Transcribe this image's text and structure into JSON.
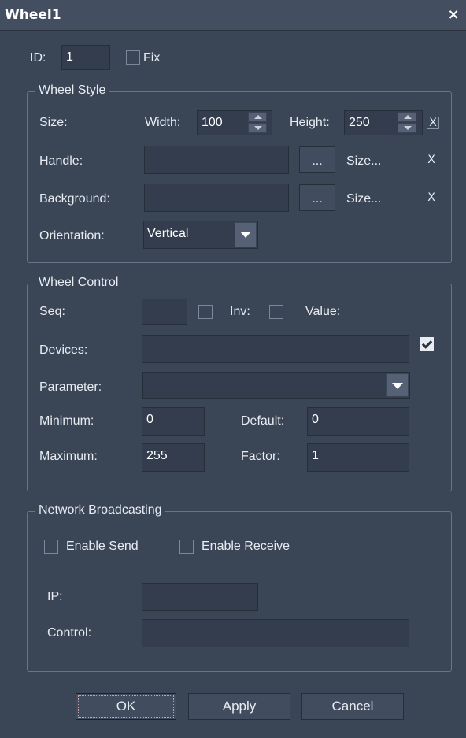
{
  "window": {
    "title": "Wheel1",
    "close_label": "×"
  },
  "id": {
    "label": "ID:",
    "value": "1",
    "fix_label": "Fix",
    "fix_checked": false
  },
  "wheel_style": {
    "title": "Wheel Style",
    "size_label": "Size:",
    "width_label": "Width:",
    "width_value": "100",
    "height_label": "Height:",
    "height_value": "250",
    "size_clear": "X",
    "handle_label": "Handle:",
    "handle_value": "",
    "handle_browse": "...",
    "handle_size": "Size...",
    "handle_clear": "X",
    "background_label": "Background:",
    "background_value": "",
    "background_browse": "...",
    "background_size": "Size...",
    "background_clear": "X",
    "orientation_label": "Orientation:",
    "orientation_value": "Vertical"
  },
  "wheel_control": {
    "title": "Wheel Control",
    "seq_label": "Seq:",
    "seq_value": "",
    "inv_label": "Inv:",
    "value_label": "Value:",
    "devices_label": "Devices:",
    "devices_value": "",
    "devices_checked": true,
    "parameter_label": "Parameter:",
    "parameter_value": "",
    "minimum_label": "Minimum:",
    "minimum_value": "0",
    "default_label": "Default:",
    "default_value": "0",
    "maximum_label": "Maximum:",
    "maximum_value": "255",
    "factor_label": "Factor:",
    "factor_value": "1"
  },
  "network": {
    "title": "Network Broadcasting",
    "enable_send": "Enable Send",
    "enable_receive": "Enable Receive",
    "ip_label": "IP:",
    "ip_value": "",
    "control_label": "Control:",
    "control_value": ""
  },
  "buttons": {
    "ok": "OK",
    "apply": "Apply",
    "cancel": "Cancel"
  },
  "colors": {
    "background": "#3a4556",
    "field": "#333d4d",
    "border": "#6a7487"
  }
}
